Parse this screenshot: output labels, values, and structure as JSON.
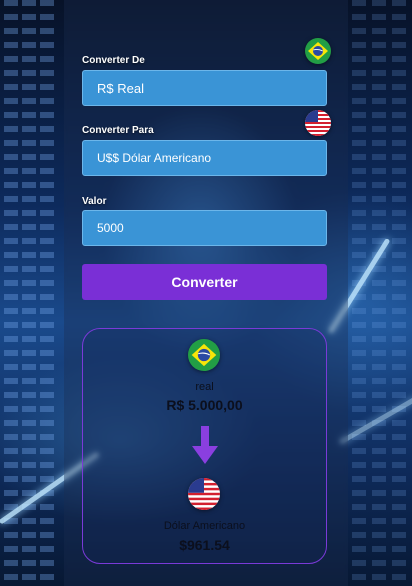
{
  "form": {
    "from_label": "Converter De",
    "from_value": "R$ Real",
    "to_label": "Converter Para",
    "to_value": "U$$ Dólar Americano",
    "amount_label": "Valor",
    "amount_value": "5000",
    "convert_button": "Converter"
  },
  "result": {
    "from_currency_name": "real",
    "from_amount": "R$ 5.000,00",
    "to_currency_name": "Dólar Americano",
    "to_amount": "$961.54"
  },
  "icons": {
    "from_flag": "brazil-flag-icon",
    "to_flag": "usa-flag-icon",
    "arrow": "arrow-down-icon"
  },
  "colors": {
    "accent": "#7a2fd6",
    "input_bg": "#3a94d6",
    "card_border": "#7a3ad8"
  }
}
